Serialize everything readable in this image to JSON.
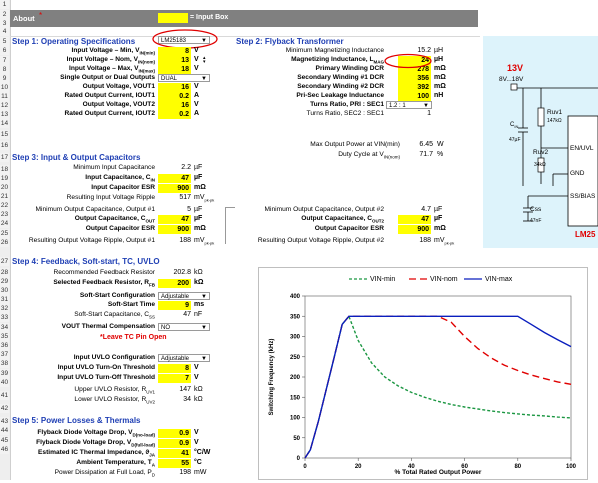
{
  "header": {
    "about": "About",
    "asterisk": "*",
    "legend_input_box": "= Input Box",
    "title_dd": "LM25183"
  },
  "rows": [
    "1",
    "2",
    "3",
    "4",
    "5",
    "6",
    "7",
    "8",
    "9",
    "10",
    "11",
    "12",
    "13",
    "14",
    "15",
    "16",
    "17",
    "18",
    "19",
    "20",
    "21",
    "22",
    "23",
    "24",
    "25",
    "26",
    "27",
    "28",
    "29",
    "30",
    "31",
    "32",
    "33",
    "34",
    "35",
    "36",
    "37",
    "38",
    "39",
    "40",
    "41",
    "42",
    "43",
    "44",
    "45",
    "46"
  ],
  "step1": {
    "title": "Step 1: Operating Specifications",
    "items": [
      {
        "label": "Input Voltage – Min, V",
        "sub": "IN(min)",
        "value": "8",
        "unit": "V"
      },
      {
        "label": "Input Voltage – Nom, V",
        "sub": "IN(nom)",
        "value": "13",
        "unit": "V"
      },
      {
        "label": "Input Voltage – Max, V",
        "sub": "IN(max)",
        "value": "18",
        "unit": "V"
      },
      {
        "label": "Single Output or Dual Outputs",
        "sub": "",
        "value": "DUAL",
        "unit": ""
      },
      {
        "label": "Output Voltage, VOUT1",
        "sub": "",
        "value": "16",
        "unit": "V"
      },
      {
        "label": "Rated Output Current, IOUT1",
        "sub": "",
        "value": "0.2",
        "unit": "A"
      },
      {
        "label": "Output Voltage, VOUT2",
        "sub": "",
        "value": "16",
        "unit": "V"
      },
      {
        "label": "Rated Output Current, IOUT2",
        "sub": "",
        "value": "0.2",
        "unit": "A"
      }
    ]
  },
  "step2": {
    "title": "Step 2: Flyback Transformer",
    "items": [
      {
        "label": "Minimum Magnetizing Inductance",
        "value": "15.2",
        "unit": "µH",
        "bold": false,
        "input": false
      },
      {
        "label": "Magnetizing Inductance, L",
        "sub": "MAG",
        "value": "24",
        "unit": "µH",
        "bold": true,
        "input": true
      },
      {
        "label": "Primary Winding DCR",
        "value": "278",
        "unit": "mΩ",
        "bold": true,
        "input": true
      },
      {
        "label": "Secondary Winding #1 DCR",
        "value": "356",
        "unit": "mΩ",
        "bold": true,
        "input": true
      },
      {
        "label": "Secondary Winding #2 DCR",
        "value": "392",
        "unit": "mΩ",
        "bold": true,
        "input": true
      },
      {
        "label": "Pri-Sec Leakage Inductance",
        "value": "100",
        "unit": "nH",
        "bold": true,
        "input": true
      },
      {
        "label": "Turns Ratio, PRI : SEC1",
        "value": "1.2 : 1",
        "unit": "",
        "bold": true,
        "input": false
      },
      {
        "label": "Turns Ratio, SEC2 : SEC1",
        "value": "1",
        "unit": "",
        "bold": false,
        "input": false
      }
    ],
    "max_power_label": "Max Output Power at VIN(min)",
    "max_power_value": "6.45",
    "max_power_unit": "W",
    "duty_label": "Duty Cycle at V",
    "duty_sub": "IN(nom)",
    "duty_value": "71.7",
    "duty_unit": "%"
  },
  "step3": {
    "title": "Step 3: Input & Output Capacitors",
    "min_in_cap_label": "Minimum Input Capacitance",
    "min_in_cap_value": "2.2",
    "min_in_cap_unit": "µF",
    "in_cap_label": "Input Capacitance, C",
    "in_cap_sub": "IN",
    "in_cap_value": "47",
    "in_cap_unit": "µF",
    "in_esr_label": "Input Capacitor ESR",
    "in_esr_value": "900",
    "in_esr_unit": "mΩ",
    "in_ripple_label": "Resulting Input Voltage Ripple",
    "in_ripple_value": "517",
    "in_ripple_unit": "mV",
    "ripple_sub": "pk-pk",
    "out1_min_label": "Minimum Output Capacitance, Output #1",
    "out1_min_value": "5",
    "out1_min_unit": "µF",
    "out1_cap_label": "Output Capacitance, C",
    "out1_cap_sub": "OUT",
    "out1_cap_value": "47",
    "out1_cap_unit": "µF",
    "out1_esr_label": "Output Capacitor ESR",
    "out1_esr_value": "900",
    "out1_esr_unit": "mΩ",
    "out1_ripple_label": "Resulting Output Voltage Ripple, Output #1",
    "out1_ripple_value": "188",
    "out1_ripple_unit": "mV",
    "out2_min_label": "Minimum Output Capacitance, Output #2",
    "out2_min_value": "4.7",
    "out2_min_unit": "µF",
    "out2_cap_label": "Output Capacitance, C",
    "out2_cap_sub": "OUT2",
    "out2_cap_value": "47",
    "out2_cap_unit": "µF",
    "out2_esr_label": "Output Capacitor ESR",
    "out2_esr_value": "900",
    "out2_esr_unit": "mΩ",
    "out2_ripple_label": "Resulting Output Voltage Ripple, Output #2",
    "out2_ripple_value": "188",
    "out2_ripple_unit": "mV"
  },
  "step4": {
    "title": "Step 4: Feedback, Soft-start, TC, UVLO",
    "rec_fb_label": "Recommended Feedback Resistor",
    "rec_fb_value": "202.8",
    "rec_fb_unit": "kΩ",
    "sel_fb_label": "Selected Feedback Resistor, R",
    "sel_fb_sub": "FB",
    "sel_fb_value": "200",
    "sel_fb_unit": "kΩ",
    "ss_cfg_label": "Soft-Start Configuration",
    "ss_cfg_value": "Adjustable",
    "ss_time_label": "Soft-Start Time",
    "ss_time_value": "9",
    "ss_time_unit": "ms",
    "ss_cap_label": "Soft-Start Capacitance, C",
    "ss_cap_sub": "SS",
    "ss_cap_value": "47",
    "ss_cap_unit": "nF",
    "tc_label": "VOUT Thermal Compensation",
    "tc_value": "NO",
    "tc_note": "*Leave TC Pin Open",
    "uvlo_cfg_label": "Input UVLO Configuration",
    "uvlo_cfg_value": "Adjustable",
    "uvlo_on_label": "Input UVLO Turn-On Threshold",
    "uvlo_on_value": "8",
    "uvlo_on_unit": "V",
    "uvlo_off_label": "Input UVLO Turn-Off Threshold",
    "uvlo_off_value": "7",
    "uvlo_off_unit": "V",
    "ruv1_label": "Upper UVLO Resistor, R",
    "ruv1_sub": "UV1",
    "ruv1_value": "147",
    "ruv1_unit": "kΩ",
    "ruv2_label": "Lower UVLO Resistor, R",
    "ruv2_sub": "UV2",
    "ruv2_value": "34",
    "ruv2_unit": "kΩ"
  },
  "step5": {
    "title": "Step 5: Power Losses & Thermals",
    "diode1_label": "Flyback Diode Voltage Drop, V",
    "diode1_sub": "D(no-load)",
    "diode1_value": "0.9",
    "diode1_unit": "V",
    "diode2_label": "Flyback Diode Voltage Drop, V",
    "diode2_sub": "D(full-load)",
    "diode2_value": "0.9",
    "diode2_unit": "V",
    "theta_label": "Estimated IC Thermal Impedance, ϑ",
    "theta_sub": "JA",
    "theta_value": "41",
    "theta_unit": "°C/W",
    "amb_label": "Ambient Temperature, T",
    "amb_sub": "A",
    "amb_value": "55",
    "amb_unit": "°C",
    "pd_label": "Power Dissipation at Full Load, P",
    "pd_sub": "D",
    "pd_value": "198",
    "pd_unit": "mW"
  },
  "schematic": {
    "vin_label": "13V",
    "vin_range": "8V...18V",
    "ruv1": "Ruv1",
    "ruv1_val": "147kΩ",
    "ruv2": "Ruv2",
    "ruv2_val": "34kΩ",
    "cin": "C",
    "cin_sub": "IN",
    "cin_val": "47µF",
    "pin_en": "EN/UVL",
    "pin_gnd": "GND",
    "pin_ss": "SS/BIAS",
    "css": "Css",
    "css_val": "47nF",
    "part": "LM25"
  },
  "chart_data": {
    "type": "line",
    "xlabel": "% Total Rated Output Power",
    "ylabel": "Switching Frequency (kHz)",
    "xlim": [
      0,
      100
    ],
    "ylim": [
      0,
      400
    ],
    "xticks": [
      0,
      20,
      40,
      60,
      80,
      100
    ],
    "yticks": [
      0,
      50,
      100,
      150,
      200,
      250,
      300,
      350,
      400
    ],
    "legend_position": "top",
    "series": [
      {
        "name": "VIN-min",
        "color": "#1a9641",
        "dash": "3,2",
        "x": [
          0,
          2,
          5,
          8,
          11,
          14,
          16.5,
          20,
          25,
          30,
          35,
          40,
          45,
          50,
          55,
          60,
          65,
          70,
          75,
          80,
          85,
          90,
          95,
          100
        ],
        "y": [
          0,
          20,
          90,
          170,
          250,
          330,
          350,
          290,
          235,
          200,
          178,
          162,
          150,
          140,
          132,
          126,
          121,
          116,
          112,
          109,
          106,
          104,
          101,
          99
        ]
      },
      {
        "name": "VIN-nom",
        "color": "#e00000",
        "dash": "7,4",
        "x": [
          0,
          2,
          5,
          8,
          11,
          14,
          16.5,
          20,
          30,
          40,
          50,
          55,
          60,
          65,
          70,
          75,
          80,
          85,
          90,
          95,
          100
        ],
        "y": [
          0,
          20,
          90,
          170,
          250,
          330,
          350,
          350,
          350,
          350,
          350,
          335,
          300,
          270,
          247,
          229,
          216,
          205,
          196,
          188,
          182
        ]
      },
      {
        "name": "VIN-max",
        "color": "#0a1ebe",
        "dash": "",
        "x": [
          0,
          2,
          5,
          8,
          11,
          14,
          16.5,
          20,
          30,
          40,
          50,
          60,
          70,
          80,
          85,
          90,
          95,
          100
        ],
        "y": [
          0,
          20,
          90,
          170,
          250,
          330,
          350,
          350,
          350,
          350,
          350,
          350,
          350,
          350,
          330,
          310,
          292,
          275
        ]
      }
    ]
  }
}
